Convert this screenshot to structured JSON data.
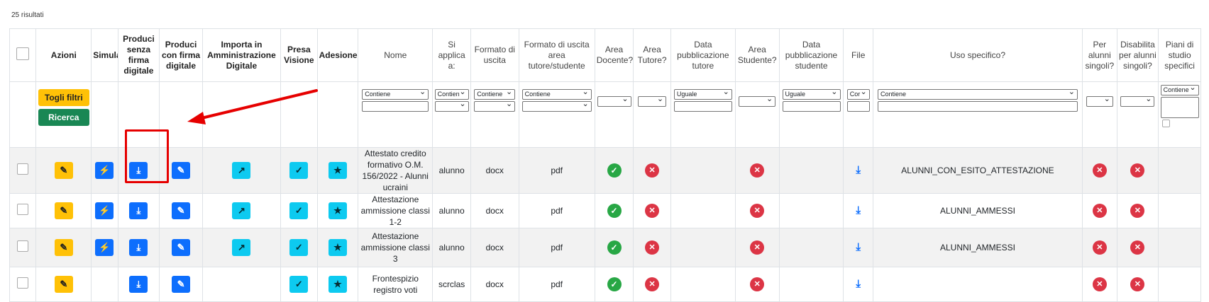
{
  "results_text": "25 risultati",
  "headers": [
    "",
    "Azioni",
    "Simula",
    "Produci senza firma digitale",
    "Produci con firma digitale",
    "Importa in Amministrazione Digitale",
    "Presa Visione",
    "Adesione",
    "Nome",
    "Si applica a:",
    "Formato di uscita",
    "Formato di uscita area tutore/studente",
    "Area Docente?",
    "Area Tutore?",
    "Data pubblicazione tutore",
    "Area Studente?",
    "Data pubblicazione studente",
    "File",
    "Uso specifico?",
    "Per alunni singoli?",
    "Disabilita per alunni singoli?",
    "Piani di studio specifici"
  ],
  "filters": {
    "togli_filtri": "Togli filtri",
    "ricerca": "Ricerca",
    "nome_op": "Contiene",
    "applica_op": "Contien",
    "formato_op": "Contiene",
    "formato_area_op": "Contiene",
    "data_tutore_op": "Uguale",
    "data_studente_op": "Uguale",
    "file_op": "Cor",
    "uso_op": "Contiene",
    "piani_op": "Contiene"
  },
  "rows": [
    {
      "nome": "Attestato credito formativo O.M. 156/2022 - Alunni ucraini",
      "applica": "alunno",
      "formato": "docx",
      "formato_area": "pdf",
      "uso": "ALUNNI_CON_ESITO_ATTESTAZIONE",
      "simula": true,
      "importa": true
    },
    {
      "nome": "Attestazione ammissione classi 1-2",
      "applica": "alunno",
      "formato": "docx",
      "formato_area": "pdf",
      "uso": "ALUNNI_AMMESSI",
      "simula": true,
      "importa": true
    },
    {
      "nome": "Attestazione ammissione classi 3",
      "applica": "alunno",
      "formato": "docx",
      "formato_area": "pdf",
      "uso": "ALUNNI_AMMESSI",
      "simula": true,
      "importa": true
    },
    {
      "nome": "Frontespizio registro voti",
      "applica": "scrclas",
      "formato": "docx",
      "formato_area": "pdf",
      "uso": "",
      "simula": false,
      "importa": false
    }
  ],
  "icons": {
    "edit": "edit-icon",
    "simula": "bolt-icon",
    "download": "download-icon",
    "pencil": "pencil-icon",
    "share": "share-icon",
    "check": "check-icon",
    "thumb": "thumbs-up-icon",
    "ok": "check-circle-icon",
    "ko": "x-circle-icon"
  },
  "colors": {
    "yellow": "#ffc107",
    "blue": "#0d6efd",
    "cyan": "#0dcaf0",
    "green": "#28a745",
    "red": "#dc3545",
    "annotation": "#e60000"
  }
}
